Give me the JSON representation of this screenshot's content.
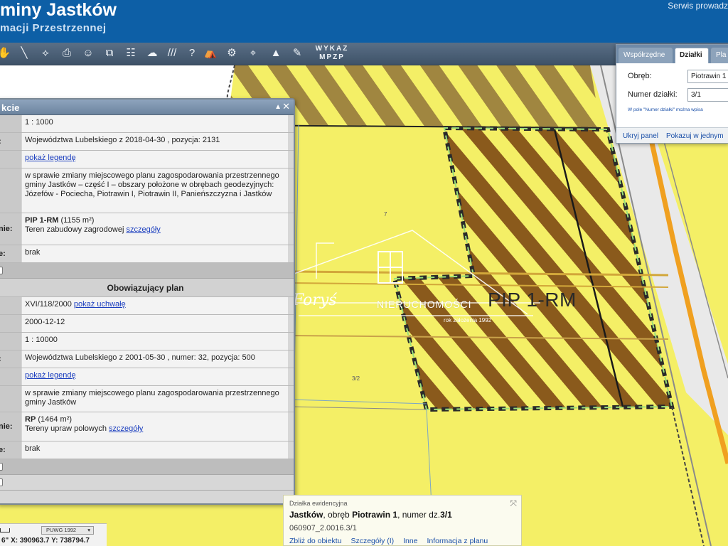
{
  "header": {
    "title": "miny Jastków",
    "subtitle": "macji Przestrzennej",
    "right_link": "Serwis prowadz"
  },
  "toolbar": {
    "tools": [
      "hand-icon",
      "measure-line-icon",
      "measure-polygon-icon",
      "print-icon",
      "person-icon",
      "layers-icon",
      "legend-icon",
      "cloud-icon",
      "hatch-icon",
      "help-icon",
      "tent-icon",
      "gears-icon",
      "locate-icon",
      "mountain-icon",
      "comment-icon"
    ],
    "help_glyph": "?",
    "hatch_glyph": "///",
    "wykaz_line1": "WYKAZ",
    "wykaz_line2": "MPZP"
  },
  "info_panel": {
    "title": "kcie",
    "rows": [
      {
        "label": "",
        "value": "1 : 1000"
      },
      {
        "label": ":",
        "value": "Województwa Lubelskiego z 2018-04-30 , pozycja: 2131"
      },
      {
        "label": "",
        "value_link": "pokaż legendę"
      },
      {
        "label": "",
        "value": "w sprawie zmiany miejscowego planu zagospodarowania przestrzennego gminy Jastków – część I – obszary położone w obrębach geodezyjnych: Józefów - Pociecha, Piotrawin I, Piotrawin II, Panieńszczyzna i Jastków"
      },
      {
        "label": "nie:",
        "code": "PIP 1-RM",
        "area": "(1155 m²)",
        "desc": "Teren zabudowy zagrodowej",
        "link": "szczegóły"
      },
      {
        "label": "e:",
        "value": "brak"
      }
    ],
    "section_title": "Obowiązujący plan",
    "rows2": [
      {
        "label": "",
        "value": "XVI/118/2000",
        "value_link": "pokaż uchwałę"
      },
      {
        "label": "",
        "value": "2000-12-12"
      },
      {
        "label": "",
        "value": "1 : 10000"
      },
      {
        "label": ":",
        "value": "Województwa Lubelskiego z 2001-05-30 , numer: 32, pozycja: 500"
      },
      {
        "label": "",
        "value_link": "pokaż legendę"
      },
      {
        "label": "",
        "value": "w sprawie zmiany miejscowego planu zagospodarowania przestrzennego gminy Jastków"
      },
      {
        "label": "nie:",
        "code": "RP",
        "area": "(1464 m²)",
        "desc": "Tereny upraw polowych",
        "link": "szczegóły"
      },
      {
        "label": "e:",
        "value": "brak"
      }
    ]
  },
  "map": {
    "zone_label": "PIP 1-RM",
    "parcel_labels": [
      "7",
      "3/2",
      "3/1"
    ],
    "watermark_name": "NIERUCHOMOŚCI",
    "watermark_year": "rok założenia 1992",
    "watermark_script": "Foryś"
  },
  "right_panel": {
    "tabs": [
      "Współrzędne",
      "Działki",
      "Pla"
    ],
    "obreb_label": "Obręb:",
    "obreb_value": "Piotrawin 1",
    "numer_label": "Numer działki:",
    "numer_value": "3/1",
    "hint": "W pole \"Numer działki\" można wpisa",
    "hide_button": "Ukryj panel",
    "show_button": "Pokazuj w jednym"
  },
  "bottom_card": {
    "caption": "Działka ewidencyjna",
    "gmina": "Jastków",
    "obreb_prefix": ", obręb ",
    "obreb": "Piotrawin 1",
    "numer_prefix": ", numer dz.",
    "numer": "3/1",
    "code": "060907_2.0016.3/1",
    "links": [
      "Zbliż do obiektu",
      "Szczegóły (I)",
      "Inne",
      "Informacja z planu"
    ]
  },
  "coords": {
    "crs": "PUWG 1992",
    "text": "6\"  X: 390963.7   Y: 738794.7"
  },
  "colors": {
    "header_blue": "#0d5fa6",
    "zone_yellow": "#f4ef66",
    "hatch_brown": "#8a5a1c",
    "link_blue": "#1c3fbf"
  }
}
